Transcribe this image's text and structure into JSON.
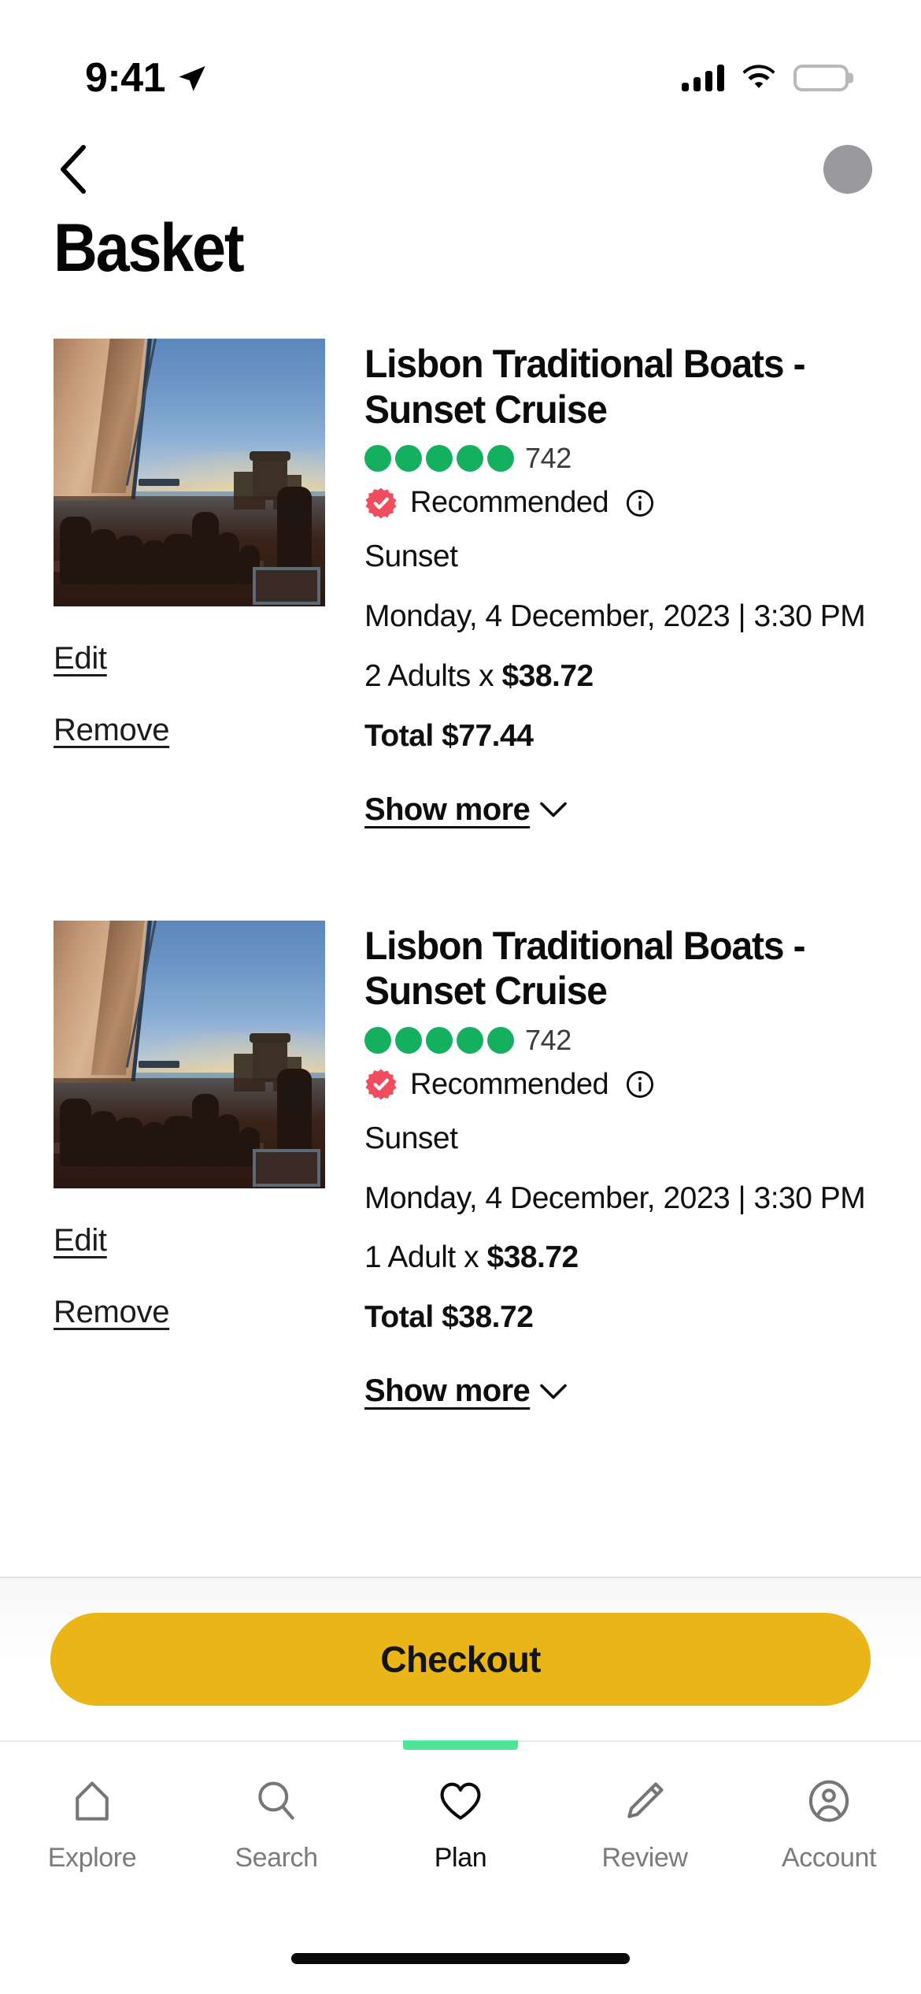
{
  "status_bar": {
    "time": "9:41",
    "location_arrow_icon": "location-arrow-icon",
    "cellular_icon": "cellular-signal-icon",
    "cellular_bars": 4,
    "wifi_icon": "wifi-icon",
    "battery_icon": "battery-full-icon"
  },
  "header": {
    "back_icon": "chevron-left-icon",
    "avatar_icon": "avatar-icon",
    "title": "Basket"
  },
  "colors": {
    "accent_yellow": "#EAB516",
    "rating_green": "#14B05F",
    "recommended_red": "#F04E5E",
    "tab_indicator_green": "#4FE49A",
    "text_primary": "#0B0B0B",
    "text_muted": "#7B7B7B"
  },
  "cart": {
    "items": [
      {
        "image_alt": "sunset-sailing-boat-photo",
        "title": "Lisbon Traditional Boats - Sunset Cruise",
        "rating_dots": 5,
        "review_count": "742",
        "badge_icon": "verified-rosette-icon",
        "badge_label": "Recommended",
        "info_icon": "info-circle-icon",
        "option": "Sunset",
        "datetime": "Monday, 4 December, 2023 | 3:30 PM",
        "qty_label": "2 Adults x ",
        "unit_price": "$38.72",
        "total": "Total $77.44",
        "edit_label": "Edit",
        "remove_label": "Remove",
        "show_more_label": "Show more",
        "chevron_icon": "chevron-down-icon"
      },
      {
        "image_alt": "sunset-sailing-boat-photo",
        "title": "Lisbon Traditional Boats - Sunset Cruise",
        "rating_dots": 5,
        "review_count": "742",
        "badge_icon": "verified-rosette-icon",
        "badge_label": "Recommended",
        "info_icon": "info-circle-icon",
        "option": "Sunset",
        "datetime": "Monday, 4 December, 2023 | 3:30 PM",
        "qty_label": "1 Adult x ",
        "unit_price": "$38.72",
        "total": "Total $38.72",
        "edit_label": "Edit",
        "remove_label": "Remove",
        "show_more_label": "Show more",
        "chevron_icon": "chevron-down-icon"
      }
    ]
  },
  "checkout": {
    "label": "Checkout"
  },
  "tabbar": {
    "active_index": 2,
    "tabs": [
      {
        "label": "Explore",
        "icon": "home-icon"
      },
      {
        "label": "Search",
        "icon": "search-icon"
      },
      {
        "label": "Plan",
        "icon": "heart-icon"
      },
      {
        "label": "Review",
        "icon": "pencil-icon"
      },
      {
        "label": "Account",
        "icon": "account-circle-icon"
      }
    ]
  }
}
